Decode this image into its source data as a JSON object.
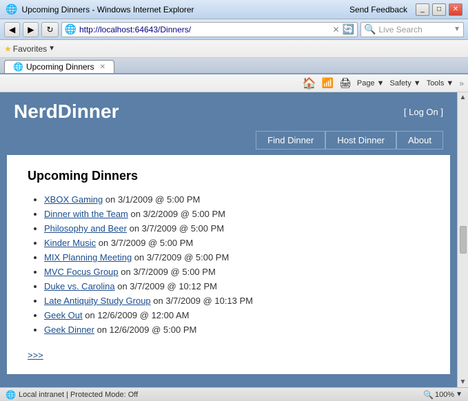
{
  "window": {
    "title": "Upcoming Dinners - Windows Internet Explorer",
    "feedback": "Send Feedback"
  },
  "address_bar": {
    "url": "http://localhost:64643/Dinners/"
  },
  "search_bar": {
    "placeholder": "Live Search"
  },
  "favorites_bar": {
    "favorites_label": "Favorites",
    "tab_label": "Upcoming Dinners"
  },
  "toolbar": {
    "page": "Page ▼",
    "safety": "Safety ▼",
    "tools": "Tools ▼"
  },
  "site": {
    "title": "NerdDinner",
    "log_on_prefix": "[ ",
    "log_on_label": "Log On",
    "log_on_suffix": " ]"
  },
  "nav": {
    "find_dinner": "Find Dinner",
    "host_dinner": "Host Dinner",
    "about": "About"
  },
  "content": {
    "heading": "Upcoming Dinners",
    "more_link": ">>>",
    "dinners": [
      {
        "name": "XBOX Gaming",
        "details": " on 3/1/2009 @ 5:00 PM"
      },
      {
        "name": "Dinner with the Team",
        "details": " on 3/2/2009 @ 5:00 PM"
      },
      {
        "name": "Philosophy and Beer",
        "details": " on 3/7/2009 @ 5:00 PM"
      },
      {
        "name": "Kinder Music",
        "details": " on 3/7/2009 @ 5:00 PM"
      },
      {
        "name": "MIX Planning Meeting",
        "details": " on 3/7/2009 @ 5:00 PM"
      },
      {
        "name": "MVC Focus Group",
        "details": " on 3/7/2009 @ 5:00 PM"
      },
      {
        "name": "Duke vs. Carolina",
        "details": " on 3/7/2009 @ 10:12 PM"
      },
      {
        "name": "Late Antiquity Study Group",
        "details": " on 3/7/2009 @ 10:13 PM"
      },
      {
        "name": "Geek Out",
        "details": " on 12/6/2009 @ 12:00 AM"
      },
      {
        "name": "Geek Dinner",
        "details": " on 12/6/2009 @ 5:00 PM"
      }
    ]
  },
  "status_bar": {
    "text": "Local intranet | Protected Mode: Off",
    "zoom": "100%"
  }
}
